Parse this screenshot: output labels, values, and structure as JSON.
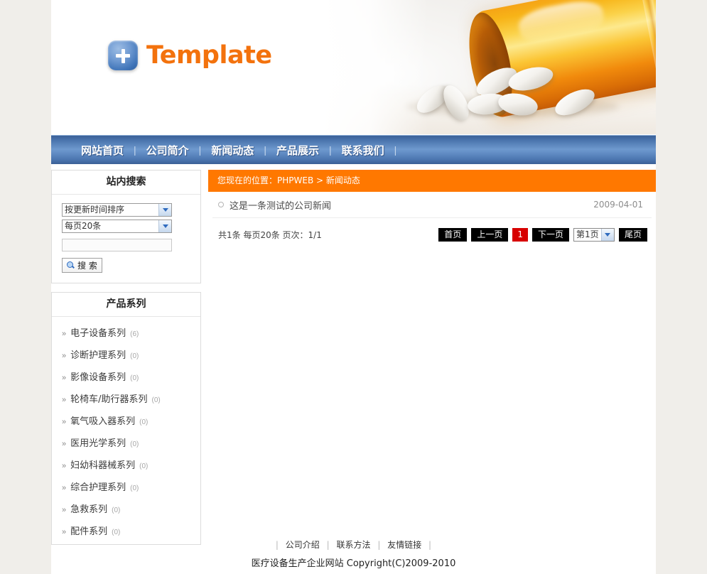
{
  "site": {
    "logo_text": "Template",
    "logo_icon": "plus-badge-icon",
    "banner_image": "pill-bottle-with-white-tablets"
  },
  "nav": {
    "items": [
      {
        "label": "网站首页"
      },
      {
        "label": "公司简介"
      },
      {
        "label": "新闻动态"
      },
      {
        "label": "产品展示"
      },
      {
        "label": "联系我们"
      }
    ],
    "separator": "|"
  },
  "sidebar": {
    "search_panel": {
      "title": "站内搜索",
      "sort_select": {
        "value": "按更新时间排序"
      },
      "pagesize_select": {
        "value": "每页20条"
      },
      "keyword_input": {
        "value": "",
        "placeholder": ""
      },
      "search_button": {
        "label": "搜 索",
        "icon": "magnifier-icon"
      }
    },
    "category_panel": {
      "title": "产品系列",
      "arrow": "»",
      "items": [
        {
          "name": "电子设备系列",
          "count": "(6)"
        },
        {
          "name": "诊断护理系列",
          "count": "(0)"
        },
        {
          "name": "影像设备系列",
          "count": "(0)"
        },
        {
          "name": "轮椅车/助行器系列",
          "count": "(0)"
        },
        {
          "name": "氧气吸入器系列",
          "count": "(0)"
        },
        {
          "name": "医用光学系列",
          "count": "(0)"
        },
        {
          "name": "妇幼科器械系列",
          "count": "(0)"
        },
        {
          "name": "综合护理系列",
          "count": "(0)"
        },
        {
          "name": "急救系列",
          "count": "(0)"
        },
        {
          "name": "配件系列",
          "count": "(0)"
        }
      ]
    }
  },
  "main": {
    "breadcrumb": "您现在的位置：PHPWEB > 新闻动态",
    "news": [
      {
        "title": "这是一条测试的公司新闻",
        "date": "2009-04-01"
      }
    ],
    "pager": {
      "info": "共1条 每页20条 页次：1/1",
      "first": "首页",
      "prev": "上一页",
      "current": "1",
      "next": "下一页",
      "page_select": "第1页",
      "last": "尾页"
    }
  },
  "footer": {
    "sep": "|",
    "links": [
      {
        "label": "公司介绍"
      },
      {
        "label": "联系方法"
      },
      {
        "label": "友情链接"
      }
    ],
    "copyright": "医疗设备生产企业网站  Copyright(C)2009-2010"
  },
  "colors": {
    "accent_orange": "#ff7800",
    "logo_orange": "#f3720d",
    "nav_blue": "#4a74ad",
    "pager_black": "#000000",
    "pager_current_red": "#d70000",
    "page_bg": "#f0eeea"
  }
}
